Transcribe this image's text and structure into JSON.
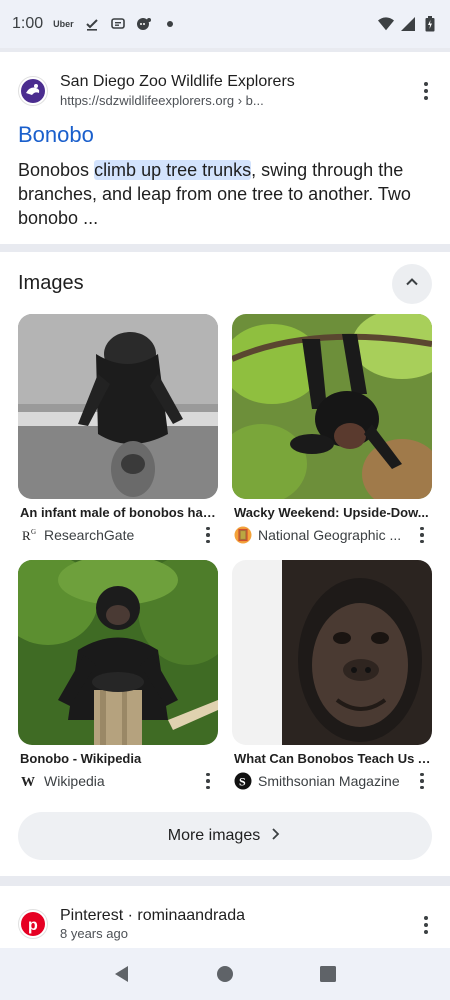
{
  "status": {
    "time": "1:00",
    "uber": "Uber"
  },
  "result1": {
    "site_name": "San Diego Zoo Wildlife Explorers",
    "site_url": "https://sdzwildlifeexplorers.org › b...",
    "title": "Bonobo",
    "snippet_before": "Bonobos ",
    "snippet_highlight": "climb up tree trunks",
    "snippet_after": ", swing through the branches, and leap from one tree to another. Two bonobo ..."
  },
  "images": {
    "heading": "Images",
    "items": [
      {
        "title": "An infant male of bonobos han...",
        "source": "ResearchGate",
        "source_icon": "researchgate-icon"
      },
      {
        "title": "Wacky Weekend: Upside-Dow...",
        "source": "National Geographic ...",
        "source_icon": "natgeo-icon"
      },
      {
        "title": "Bonobo - Wikipedia",
        "source": "Wikipedia",
        "source_icon": "wikipedia-icon"
      },
      {
        "title": "What Can Bonobos Teach Us A...",
        "source": "Smithsonian Magazine",
        "source_icon": "smithsonian-icon"
      }
    ],
    "more_label": "More images"
  },
  "result3": {
    "site_name": "Pinterest · rominaandrada",
    "time": "8 years ago"
  },
  "colors": {
    "link": "#1a5fcc",
    "highlight": "#d3e3fd",
    "pinterest": "#e60023"
  }
}
